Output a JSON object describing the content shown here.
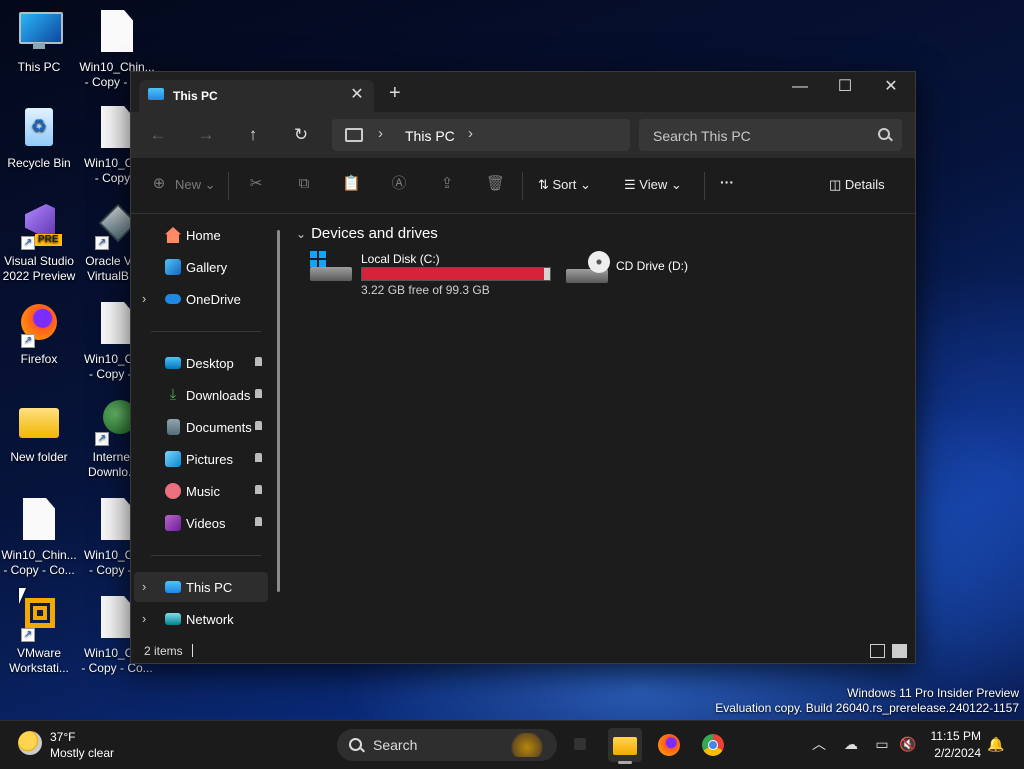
{
  "desktop": {
    "icons": [
      {
        "label": "This PC"
      },
      {
        "label": "Win10_Chin...\n- Copy - C..."
      },
      {
        "label": "Recycle Bin"
      },
      {
        "label": "Win10_Ch...\n- Copy..."
      },
      {
        "label": "Visual Studio\n2022 Preview"
      },
      {
        "label": "Oracle V...\nVirtualB..."
      },
      {
        "label": "Firefox"
      },
      {
        "label": "Win10_Ch...\n- Copy - ..."
      },
      {
        "label": "New folder"
      },
      {
        "label": "Internet\nDownlo..."
      },
      {
        "label": "Win10_Chin...\n- Copy - Co..."
      },
      {
        "label": "Win10_Ch...\n- Copy - ..."
      },
      {
        "label": "VMware\nWorkstati..."
      },
      {
        "label": "Win10_Ch...\n- Copy - Co..."
      }
    ],
    "vs_badge": "PRE",
    "watermark": {
      "line1": "Windows 11 Pro Insider Preview",
      "line2": "Evaluation copy. Build 26040.rs_prerelease.240122-1157"
    }
  },
  "window": {
    "tab_title": "This PC",
    "tab_close": "✕",
    "new_tab": "+",
    "caption": {
      "minimize": "—",
      "maximize": "☐",
      "close": "✕"
    },
    "nav": {
      "back": "←",
      "forward": "→",
      "up": "↑",
      "refresh": "↻"
    },
    "address": {
      "chevron": "›",
      "crumb": "This PC"
    },
    "search": {
      "placeholder": "Search This PC"
    },
    "commands": {
      "new_label": "New",
      "sort_label": "Sort",
      "view_label": "View",
      "more": "···",
      "details_label": "Details"
    },
    "sidebar": {
      "items": [
        {
          "label": "Home",
          "icon": "home-icon"
        },
        {
          "label": "Gallery",
          "icon": "gallery-icon"
        },
        {
          "label": "OneDrive",
          "icon": "onedrive-icon"
        },
        {
          "label": "Desktop",
          "icon": "desktop-icon"
        },
        {
          "label": "Downloads",
          "icon": "downloads-icon"
        },
        {
          "label": "Documents",
          "icon": "documents-icon"
        },
        {
          "label": "Pictures",
          "icon": "pictures-icon"
        },
        {
          "label": "Music",
          "icon": "music-icon"
        },
        {
          "label": "Videos",
          "icon": "videos-icon"
        },
        {
          "label": "This PC",
          "icon": "this-pc-icon",
          "selected": true
        },
        {
          "label": "Network",
          "icon": "network-icon"
        }
      ]
    },
    "content": {
      "section_title": "Devices and drives",
      "section_arrow": "⌄",
      "drives": [
        {
          "name": "Local Disk (C:)",
          "free_text": "3.22 GB free of 99.3 GB",
          "used_fraction": 0.968,
          "bar_color": "#d5243a"
        },
        {
          "name": "CD Drive (D:)"
        }
      ]
    },
    "status": {
      "item_count": "2 items"
    }
  },
  "taskbar": {
    "weather": {
      "temp": "37°F",
      "condition": "Mostly clear"
    },
    "search_label": "Search",
    "tray_chevron": "︿",
    "clock": {
      "time": "11:15 PM",
      "date": "2/2/2024"
    }
  },
  "colors": {
    "accent": "#0ea5ff",
    "disk_used": "#d5243a"
  }
}
